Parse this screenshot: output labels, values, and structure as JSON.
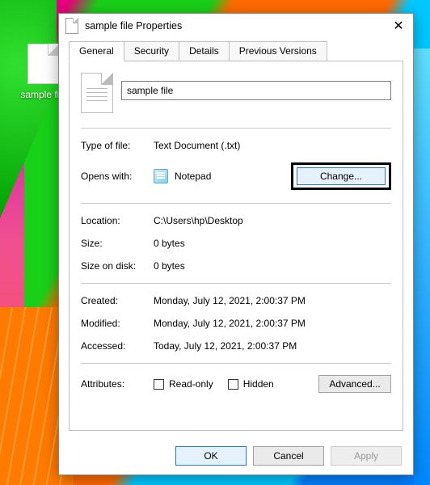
{
  "desktop": {
    "icon_label": "sample file"
  },
  "window": {
    "title": "sample file Properties",
    "tabs": {
      "general": "General",
      "security": "Security",
      "details": "Details",
      "previous": "Previous Versions"
    },
    "file_name": "sample file",
    "labels": {
      "type": "Type of file:",
      "opens": "Opens with:",
      "location": "Location:",
      "size": "Size:",
      "sod": "Size on disk:",
      "created": "Created:",
      "modified": "Modified:",
      "accessed": "Accessed:",
      "attributes": "Attributes:"
    },
    "values": {
      "type": "Text Document (.txt)",
      "opens": "Notepad",
      "location": "C:\\Users\\hp\\Desktop",
      "size": "0 bytes",
      "sod": "0 bytes",
      "created": "Monday, July 12, 2021, 2:00:37 PM",
      "modified": "Monday, July 12, 2021, 2:00:37 PM",
      "accessed": "Today, July 12, 2021, 2:00:37 PM"
    },
    "buttons": {
      "change": "Change...",
      "advanced": "Advanced...",
      "ok": "OK",
      "cancel": "Cancel",
      "apply": "Apply"
    },
    "attr": {
      "readonly": "Read-only",
      "hidden": "Hidden"
    }
  }
}
